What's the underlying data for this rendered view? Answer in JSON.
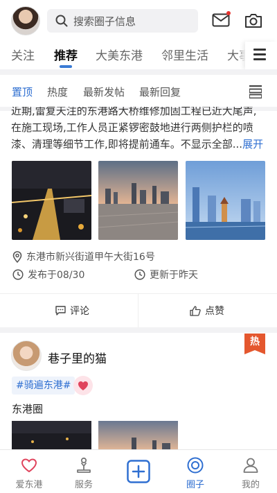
{
  "header": {
    "search_placeholder": "搜索圈子信息",
    "icons": [
      "avatar",
      "search-icon",
      "mail-icon",
      "camera-icon"
    ],
    "mail_has_dot": true
  },
  "tabs": {
    "items": [
      "关注",
      "推荐",
      "大美东港",
      "邻里生活",
      "大事"
    ],
    "active": "推荐"
  },
  "sort": {
    "items": [
      "置顶",
      "热度",
      "最新发帖",
      "最新回复"
    ],
    "active": "置顶"
  },
  "post1": {
    "text_line0": "近期,雷复天注的东港路大桥维修加固工程已近大尾声,",
    "text_line1": "在施工现场,工作人员正紧锣密鼓地进行两侧护栏的喷",
    "text_line2": "漆、清理等细节工作,即将提前通车。不显示全部...",
    "expand": "展开",
    "location": "东港市新兴街道甲午大街16号",
    "published": "发布于08/30",
    "updated": "更新于昨天",
    "comment": "评论",
    "like": "点赞"
  },
  "post2": {
    "author": "巷子里的猫",
    "hot_badge": "热",
    "tag": "#骑遍东港#",
    "circle": "东港圈"
  },
  "bottom_nav": {
    "items": [
      "爱东港",
      "服务",
      "",
      "圈子",
      "我的"
    ],
    "active": "圈子"
  },
  "colors": {
    "accent": "#2f6fd1",
    "hot": "#e4572e",
    "heart": "#e0435c"
  }
}
